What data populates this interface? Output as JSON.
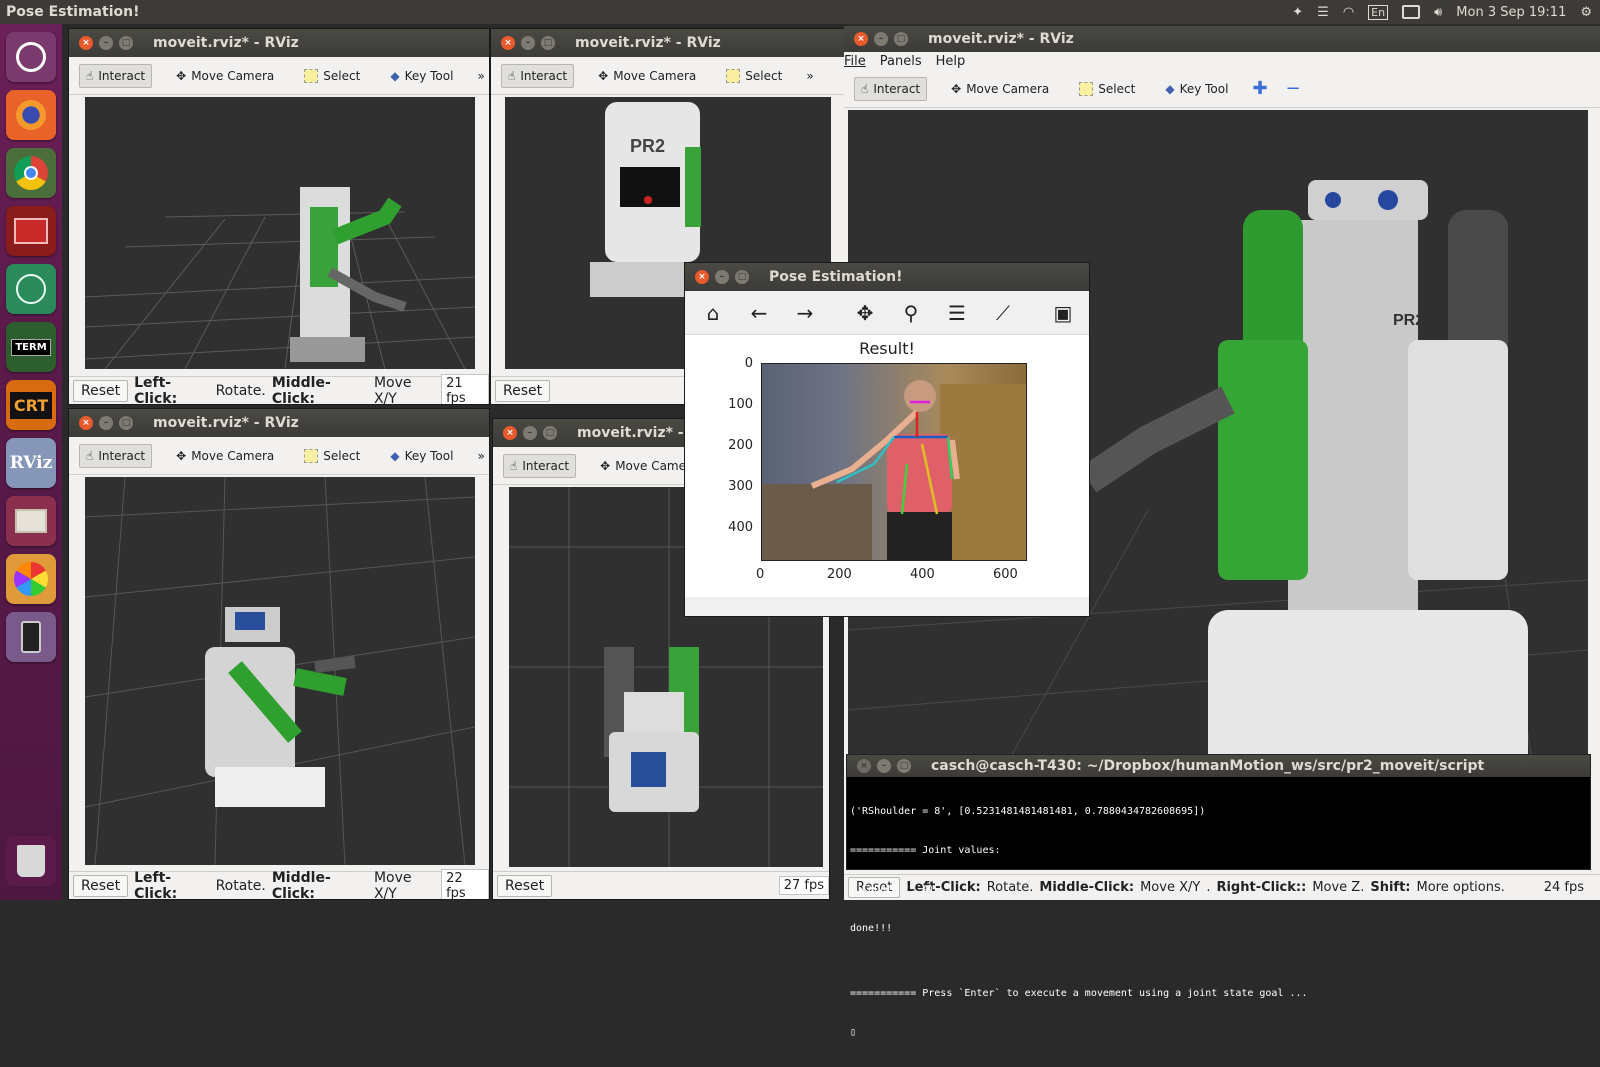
{
  "topbar": {
    "app_title": "Pose Estimation!",
    "keyboard_layout": "En",
    "clock": "Mon  3 Sep 19:11"
  },
  "launcher": {
    "items": [
      "Ubuntu",
      "Firefox",
      "Chrome",
      "Terminal",
      "Atom",
      "XTerm",
      "CRT",
      "RViz",
      "Files",
      "App",
      "Phone",
      "Trash"
    ],
    "xterm_label": "TERM",
    "crt_label": "CRT",
    "rviz_label": "RViz"
  },
  "rviz_title": "moveit.rviz* - RViz",
  "toolbar": {
    "interact": "Interact",
    "move_camera": "Move Camera",
    "select": "Select",
    "key_tool": "Key Tool",
    "more": "»"
  },
  "menu": {
    "file": "File",
    "panels": "Panels",
    "help": "Help"
  },
  "status": {
    "reset": "Reset",
    "left_click": "Left-Click:",
    "rotate": " Rotate. ",
    "middle_click": "Middle-Click:",
    "move_xy": " Move X/Y",
    "right_click": "Right-Click::",
    "move_z": " Move Z. ",
    "shift": "Shift:",
    "more_options": " More options."
  },
  "fps": {
    "tl": "21 fps",
    "bl": "22 fps",
    "bm": "27 fps",
    "main": "24 fps"
  },
  "robot_label": "PR2",
  "pose_window": {
    "title": "Pose Estimation!",
    "plot_title": "Result!",
    "y_ticks": [
      "0",
      "100",
      "200",
      "300",
      "400"
    ],
    "x_ticks": [
      "0",
      "200",
      "400",
      "600"
    ]
  },
  "terminal": {
    "title": "casch@casch-T430: ~/Dropbox/humanMotion_ws/src/pr2_moveit/script",
    "lines": [
      "('RShoulder = 8', [0.5231481481481481, 0.7880434782608695])",
      "=========== Joint values:",
      "('Counte:', 4)",
      "done!!!",
      "",
      "=========== Press `Enter` to execute a movement using a joint state goal ...",
      "▯"
    ]
  }
}
